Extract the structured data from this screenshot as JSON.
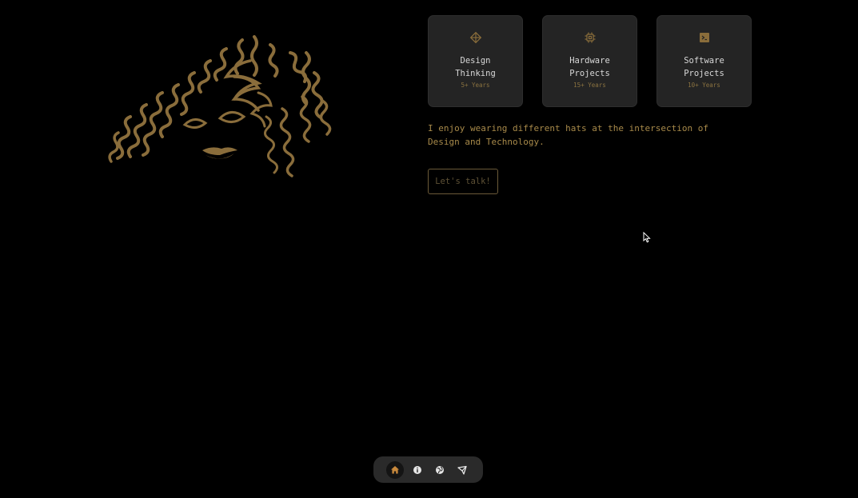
{
  "colors": {
    "background": "#000000",
    "accent": "#8a6d3b",
    "card_bg": "#242424",
    "text_light": "#d8d8d8",
    "text_gold": "#a88a4a"
  },
  "illustration": {
    "icon": "curly-hair-face-illustration"
  },
  "cards": [
    {
      "icon": "diamond-icon",
      "title": "Design Thinking",
      "years": "5+ Years"
    },
    {
      "icon": "chip-icon",
      "title": "Hardware Projects",
      "years": "15+ Years"
    },
    {
      "icon": "terminal-icon",
      "title": "Software Projects",
      "years": "10+ Years"
    }
  ],
  "intro": {
    "text": "I enjoy wearing different hats at the intersection of Design and Technology."
  },
  "cta": {
    "label": "Let's talk!"
  },
  "dock": {
    "items": [
      {
        "icon": "home-icon",
        "active": true
      },
      {
        "icon": "info-icon",
        "active": false
      },
      {
        "icon": "globe-icon",
        "active": false
      },
      {
        "icon": "send-icon",
        "active": false
      }
    ]
  }
}
